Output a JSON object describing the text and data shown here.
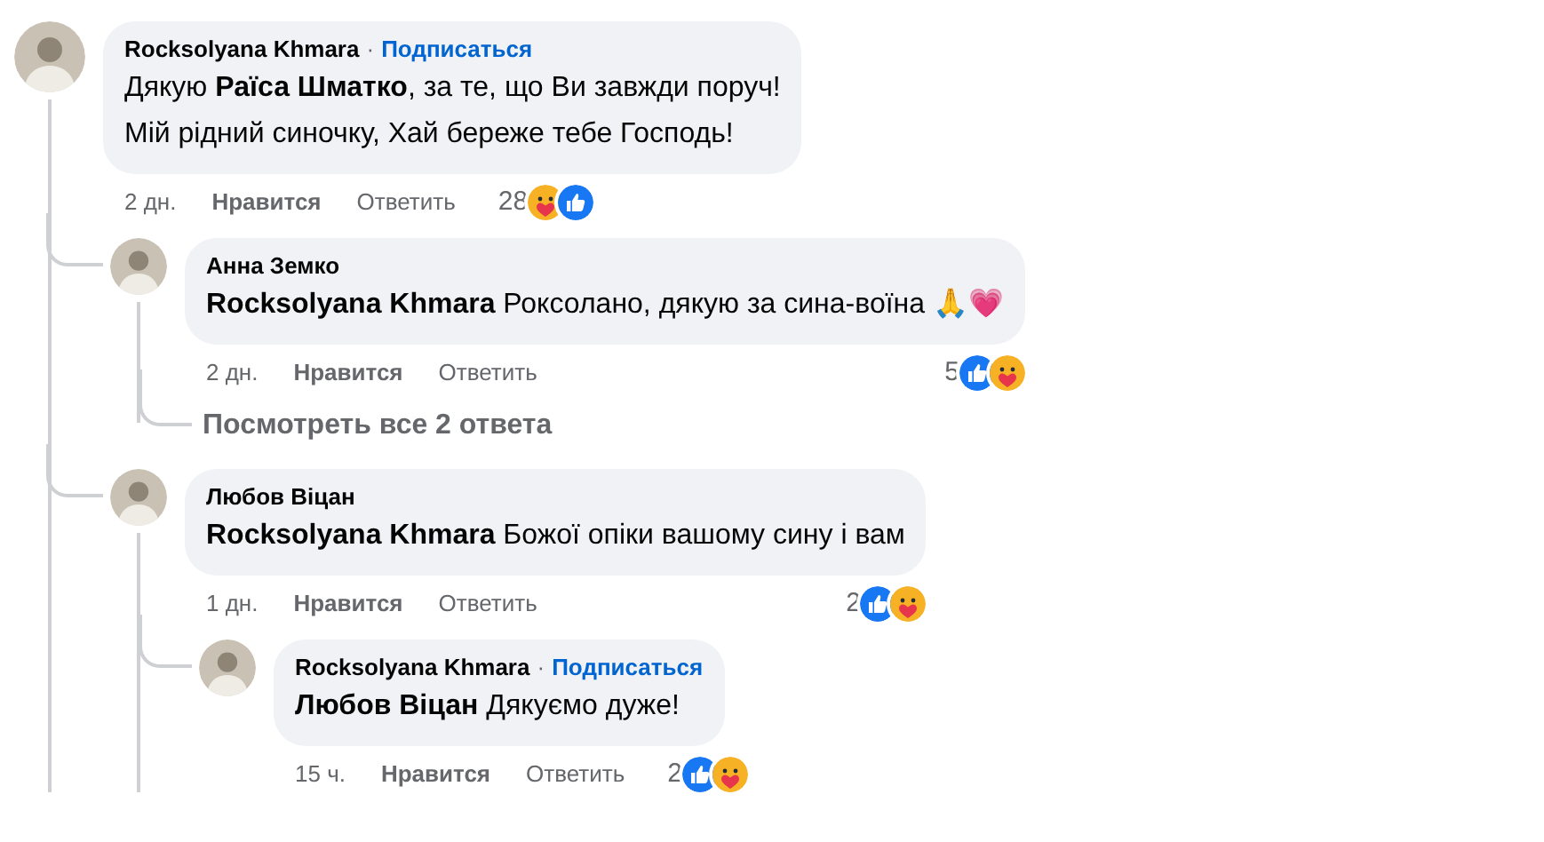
{
  "comments": [
    {
      "author": "Rocksolyana Khmara",
      "separator": "·",
      "follow": "Подписаться",
      "text": "Дякую **Раїса Шматко**, за те, що Ви завжди поруч!\nМій рідний синочку, Хай береже тебе Господь!",
      "time": "2 дн.",
      "like": "Нравится",
      "reply": "Ответить",
      "reaction_count": "28",
      "reactions": [
        {
          "kind": "care"
        },
        {
          "kind": "like"
        }
      ],
      "replies": [
        {
          "author": "Анна Земко",
          "text": "**Rocksolyana Khmara** Роксолано, дякую за сина-воїна 🙏💗",
          "time": "2 дн.",
          "like": "Нравится",
          "reply": "Ответить",
          "reaction_count": "5",
          "reactions": [
            {
              "kind": "like"
            },
            {
              "kind": "care"
            }
          ],
          "more_replies": "Посмотреть все 2 ответа"
        },
        {
          "author": "Любов Віцан",
          "text": "**Rocksolyana Khmara** Божої опіки вашому сину і вам",
          "time": "1 дн.",
          "like": "Нравится",
          "reply": "Ответить",
          "reaction_count": "2",
          "reactions": [
            {
              "kind": "like"
            },
            {
              "kind": "care"
            }
          ],
          "replies": [
            {
              "author": "Rocksolyana Khmara",
              "separator": "·",
              "follow": "Подписаться",
              "text": "**Любов Віцан** Дякуємо дуже!",
              "time": "15 ч.",
              "like": "Нравится",
              "reply": "Ответить",
              "reaction_count": "2",
              "reactions": [
                {
                  "kind": "like"
                },
                {
                  "kind": "care"
                }
              ]
            }
          ]
        }
      ]
    }
  ]
}
